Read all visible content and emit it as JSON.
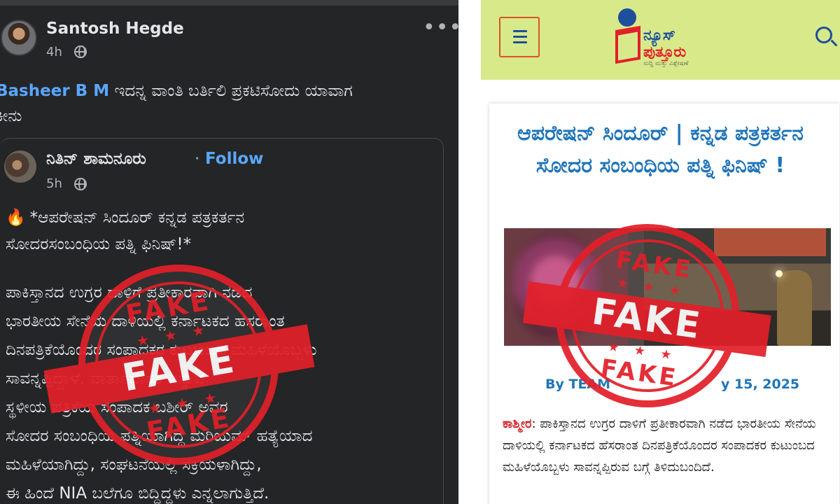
{
  "left_post": {
    "author": "Santosh Hegde",
    "time": "4h",
    "more": "•••",
    "comment_mention": "Basheer B M",
    "comment_text": "ಇದನ್ನ ವಾಂತಿ ಬರ್ತಿಲಿ ಪ್ರಕಟಿಸೋದು ಯಾವಾಗ",
    "comment_text_line2": "ಕೀನು",
    "shared": {
      "author": "ನಿತಿನ್ ಶಾಮನೂರು",
      "separator": "·",
      "follow_label": "Follow",
      "time": "5h",
      "fire": "🔥",
      "title_line1": "*ಆಪರೇಷನ್ ಸಿಂದೂರ್ ಕನ್ನಡ ಪತ್ರಕರ್ತನ",
      "title_line2": "ಸೋದರಸಂಬಂಧಿಯ ಪತ್ನಿ ಫಿನಿಷ್!*",
      "body_lines": [
        "ಪಾಕಿಸ್ತಾನದ ಉಗ್ರರ ದಾಳಿಗೆ ಪ್ರತೀಕಾರವಾಗಿ ನಡೆದ",
        "ಭಾರತೀಯ ಸೇನೆಯ ದಾಳಿಯಲ್ಲಿ ಕರ್ನಾಟಕದ ಹೆಸರಾಂತ",
        "ದಿನಪತ್ರಿಕೆಯೊಂದರ ಸಂಪಾದಕರ ಕುಟುಂಬದ ಮಹಿಳೆಯೊಬ್ಬಳು",
        "ಸಾವನ್ನಪ್ಪಿದ್ದಾಳೆ. ವಾರ್ತಾಭಾರತಿ ಎನ್ನುವ",
        "ಸ್ಥಳೀಯ ಪತ್ರಿಕೆಯ ಸಂಪಾದಕ ಬಶೀರ್ ಅವರ",
        "ಸೋದರ ಸಂಬಂಧಿಯ ಪತ್ನಿಯಾಗಿದ್ದ ಮರಿಯಮ್ ಹತ್ಯೆಯಾದ",
        "ಮಹಿಳೆಯಾಗಿದ್ದು, ಸಂಘಟನೆಯಲ್ಲಿ ಸಕ್ರಿಯಳಾಗಿದ್ದು,",
        "ಈ ಹಿಂದೆ NIA ಬಲೆಗೂ ಬಿದ್ದಿದ್ದಳು ಎನ್ನಲಾಗುತ್ತಿದೆ."
      ]
    }
  },
  "stamp": {
    "top": "FAKE",
    "middle": "FAKE",
    "bottom": "FAKE",
    "stars": "★ ★ ★",
    "color": "#e2202a"
  },
  "news_site": {
    "logo_line1": "ನ್ಯೂಸ್",
    "logo_line2": "ಪುತ್ತೂರು",
    "logo_tagline": "ಸುದ್ದಿ ಮತ್ತು ವಿಶ್ಲೇಷಣೆ",
    "header_color": "#d8e98a",
    "headline": "ಆಪರೇಷನ್ ಸಿಂದೂರ್ | ಕನ್ನಡ ಪತ್ರಕರ್ತನ ಸೋದರ ಸಂಬಂಧಿಯ ಪತ್ನಿ ಫಿನಿಷ್ !",
    "byline_left": "By TEAM",
    "byline_right": "y 15, 2025",
    "dateline": "ಕಾಶ್ಮೀರ",
    "article": ": ಪಾಕಿಸ್ತಾನದ ಉಗ್ರರ ದಾಳಿಗೆ ಪ್ರತೀಕಾರವಾಗಿ ನಡೆದ ಭಾರತೀಯ ಸೇನೆಯ ದಾಳಿಯಲ್ಲಿ ಕರ್ನಾಟಕದ ಹೆಸರಾಂತ ದಿನಪತ್ರಿಕೆಯೊಂದರ ಸಂಪಾದಕರ ಕುಟುಂಬದ ಮಹಿಳೆಯೊಬ್ಬಳು ಸಾವನ್ನಪ್ಪಿರುವ ಬಗ್ಗೆ ತಿಳಿದುಬಂದಿದೆ."
  }
}
